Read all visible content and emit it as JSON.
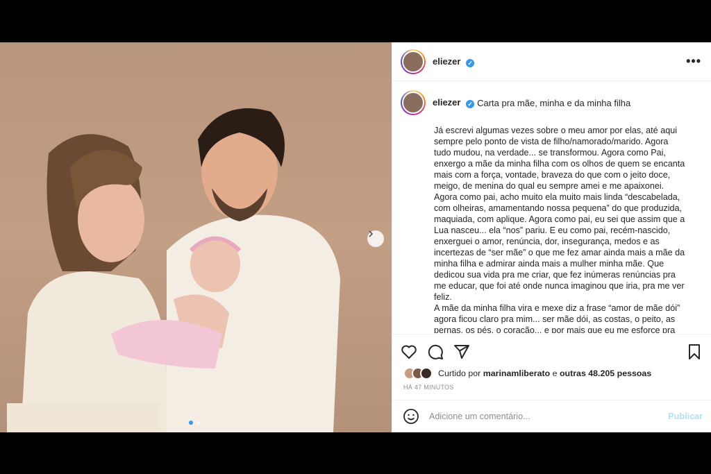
{
  "post": {
    "username": "eliezer",
    "verified_mark": "✓",
    "more_label": "•••",
    "caption_title": "Carta pra mãe, minha e da minha filha",
    "caption_body": "Já escrevi algumas vezes sobre o meu amor por elas, até aqui\nsempre pelo ponto de vista de filho/namorado/marido. Agora\ntudo mudou, na verdade... se transformou. Agora como Pai,\nenxergo a mãe da minha filha com os olhos de quem se encanta\nmais com a força, vontade, braveza do que com o jeito doce,\nmeigo, de menina do qual eu sempre amei e me apaixonei.\nAgora como pai, acho muito ela muito mais linda “descabelada,\ncom olheiras, amamentando nossa pequena” do que produzida,\nmaquiada, com aplique. Agora como pai, eu sei que assim que a\nLua nasceu... ela “nos” pariu. E eu como pai, recém-nascido,\nenxerguei o amor, renúncia, dor, insegurança, medos e as\nincertezas de “ser mãe” o que me fez amar ainda mais a mãe da\nminha filha e admirar ainda mais a mulher minha mãe. Que\ndedicou sua vida pra me criar, que fez inúmeras renúncias pra\nme educar, que foi até onde nunca imaginou que iria, pra me ver\nfeliz.\nA mãe da minha filha vira e mexe diz a frase “amor de mãe dói”\nagora ficou claro pra mim... ser mãe dói, as costas, o peito, as\npernas, os pés, o coração... e por mais que eu me esforce pra",
    "likes_prefix": "Curtido por",
    "likes_user": "marinamliberato",
    "likes_mid": "e",
    "likes_others": "outras 48.205 pessoas",
    "time_ago": "HÁ 47 MINUTOS",
    "comment_placeholder": "Adicione um comentário...",
    "publish_label": "Publicar"
  },
  "carousel": {
    "current_index": 1,
    "total": 2
  },
  "icons": [
    "heart-icon",
    "comment-icon",
    "share-icon",
    "bookmark-icon",
    "emoji-icon",
    "chevron-right-icon",
    "more-icon",
    "verified-icon"
  ],
  "colors": {
    "accent": "#3897f0",
    "publish_disabled": "#b2dffc",
    "backdrop": "#c29e84"
  }
}
